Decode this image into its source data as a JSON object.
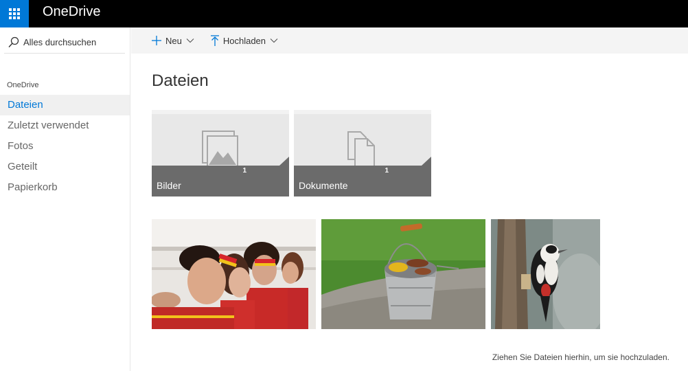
{
  "header": {
    "app_title": "OneDrive",
    "waffle_icon": "app-launcher-icon",
    "accent": "#0078d7"
  },
  "search": {
    "placeholder": "Alles durchsuchen"
  },
  "sidebar": {
    "section": "OneDrive",
    "items": [
      {
        "label": "Dateien",
        "active": true
      },
      {
        "label": "Zuletzt verwendet"
      },
      {
        "label": "Fotos"
      },
      {
        "label": "Geteilt"
      },
      {
        "label": "Papierkorb"
      }
    ]
  },
  "commands": {
    "new_label": "Neu",
    "upload_label": "Hochladen"
  },
  "main": {
    "title": "Dateien",
    "folders": [
      {
        "name": "Bilder",
        "count": "1",
        "icon": "pictures-folder-icon"
      },
      {
        "name": "Dokumente",
        "count": "1",
        "icon": "documents-folder-icon"
      }
    ],
    "photos": [
      {
        "subject": "spain-fans-photo"
      },
      {
        "subject": "bucket-grill-photo"
      },
      {
        "subject": "woodpecker-photo"
      }
    ],
    "drop_hint": "Ziehen Sie Dateien hierhin, um sie hochzuladen."
  }
}
